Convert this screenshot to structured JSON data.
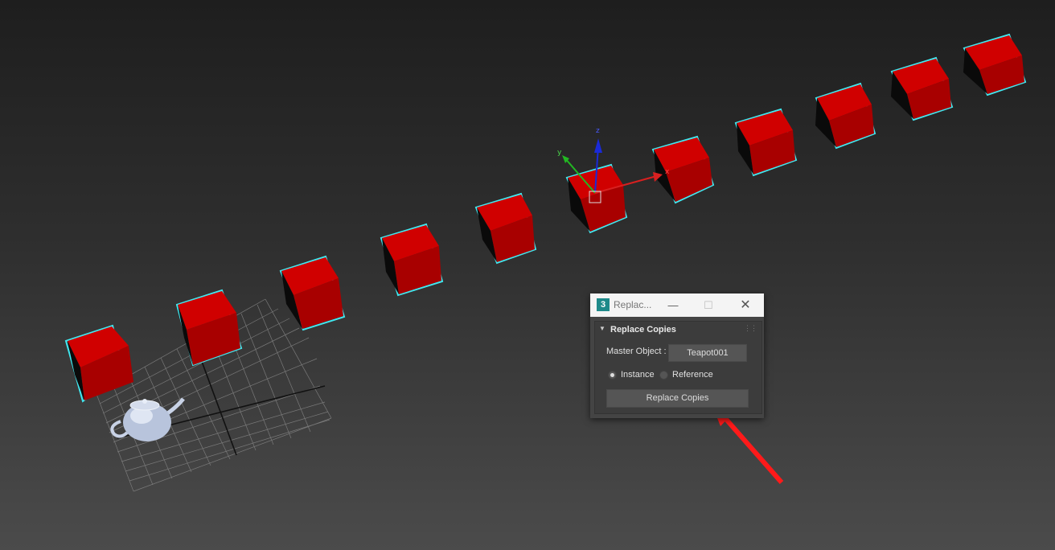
{
  "dialog": {
    "app_icon": "3",
    "window_title": "Replac...",
    "window_controls": {
      "minimize_icon": "minimize-icon",
      "maximize_icon": "maximize-icon",
      "close_icon": "close-icon"
    },
    "rollout_title": "Replace Copies",
    "master_object_label": "Master Object :",
    "master_object_value": "Teapot001",
    "mode_options": [
      {
        "label": "Instance",
        "selected": true
      },
      {
        "label": "Reference",
        "selected": false
      }
    ],
    "replace_button_label": "Replace Copies"
  },
  "viewport": {
    "gizmo_axes": {
      "x": "x",
      "y": "y",
      "z": "z"
    },
    "colors": {
      "box_red": "#cc0000",
      "selection": "#40e8f0",
      "arrow": "#ff1a1a"
    }
  }
}
